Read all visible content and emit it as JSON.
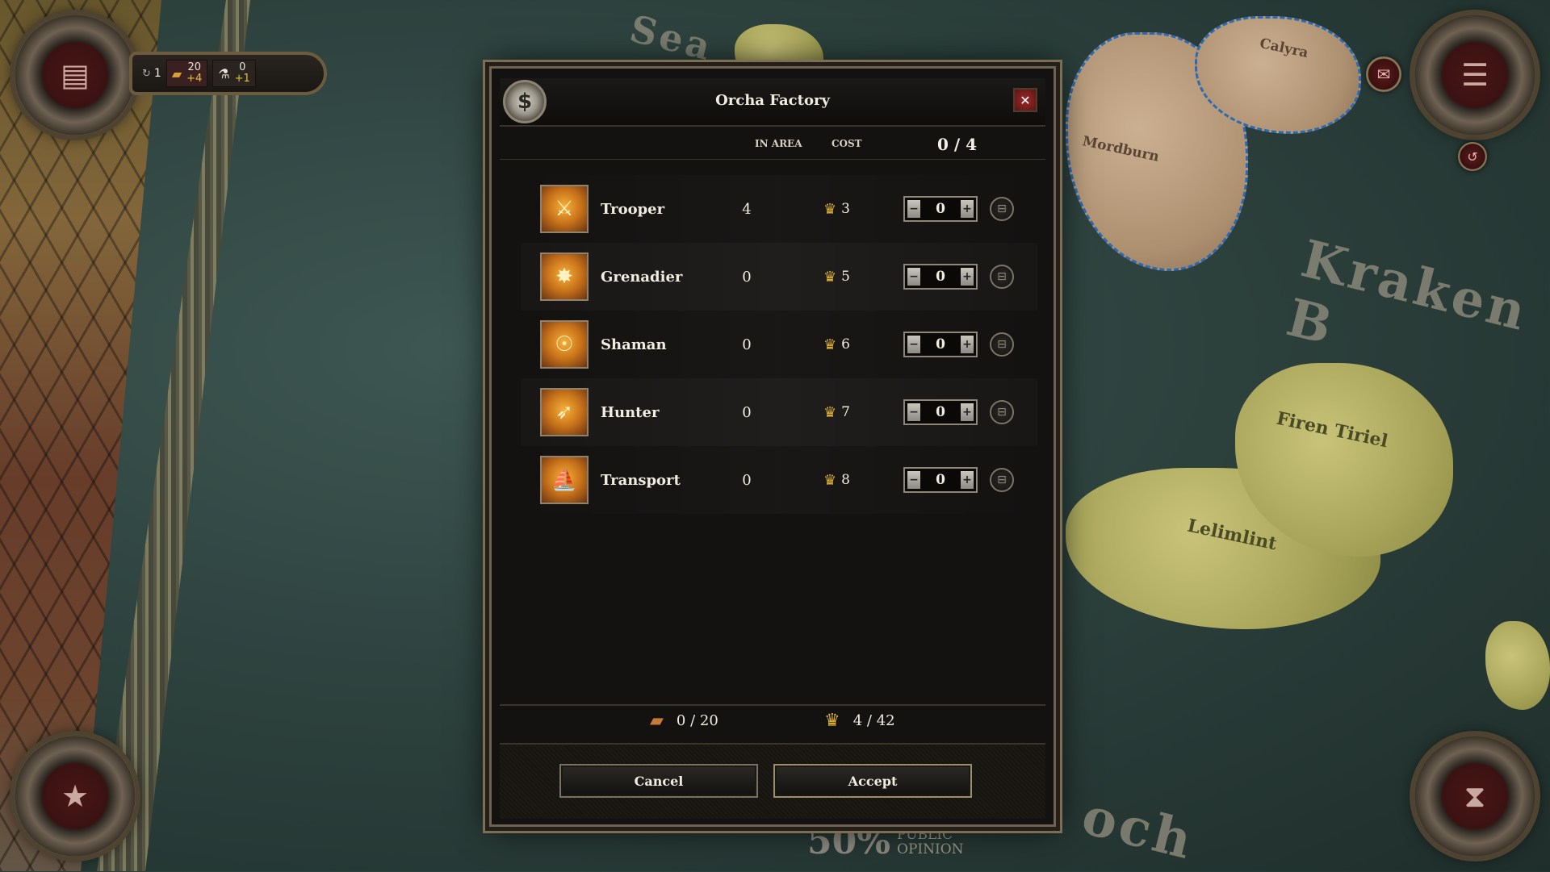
{
  "hud": {
    "turns": "1",
    "troops_value": "20",
    "troops_delta": "+4",
    "research_value": "0",
    "research_delta": "+1",
    "opinion_pct": "50%",
    "opinion_label_1": "PUBLIC",
    "opinion_label_2": "OPINION"
  },
  "map": {
    "sea_word": "Kraken B",
    "sea_word_2": "Sea",
    "sea_word_3": "och",
    "regions": [
      "Firen Tiriel",
      "Lelimlint",
      "Mordburn",
      "Calyra"
    ]
  },
  "dialog": {
    "title": "Orcha Factory",
    "col_in_area": "IN AREA",
    "col_cost": "COST",
    "selected_count": "0 / 4",
    "units": [
      {
        "name": "Trooper",
        "in_area": "4",
        "cost": "3",
        "qty": "0"
      },
      {
        "name": "Grenadier",
        "in_area": "0",
        "cost": "5",
        "qty": "0"
      },
      {
        "name": "Shaman",
        "in_area": "0",
        "cost": "6",
        "qty": "0"
      },
      {
        "name": "Hunter",
        "in_area": "0",
        "cost": "7",
        "qty": "0"
      },
      {
        "name": "Transport",
        "in_area": "0",
        "cost": "8",
        "qty": "0"
      }
    ],
    "capacity": "0 / 20",
    "gold": "4 / 42",
    "cancel_label": "Cancel",
    "accept_label": "Accept"
  },
  "colors": {
    "accent_gold": "#e0b432",
    "close_red": "#9b2a2a",
    "water_border": "#2a6ab8"
  }
}
